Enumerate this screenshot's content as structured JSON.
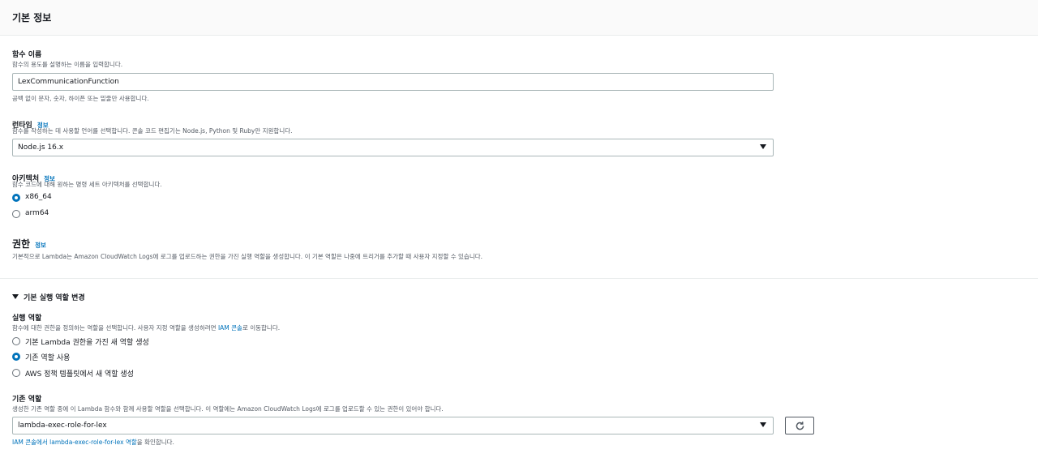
{
  "panel": {
    "title": "기본 정보"
  },
  "function_name": {
    "label": "함수 이름",
    "description": "함수의 용도를 설명하는 이름을 입력합니다.",
    "value": "LexCommunicationFunction",
    "hint": "공백 없이 문자, 숫자, 하이픈 또는 밑줄만 사용합니다."
  },
  "runtime": {
    "label": "런타임",
    "info": "정보",
    "description": "함수를 작성하는 데 사용할 언어를 선택합니다. 콘솔 코드 편집기는 Node.js, Python 및 Ruby만 지원합니다.",
    "value": "Node.js 16.x"
  },
  "architecture": {
    "label": "아키텍처",
    "info": "정보",
    "description": "함수 코드에 대해 원하는 명령 세트 아키텍처를 선택합니다.",
    "options": [
      "x86_64",
      "arm64"
    ],
    "selected": "x86_64"
  },
  "permissions": {
    "title": "권한",
    "info": "정보",
    "description": "기본적으로 Lambda는 Amazon CloudWatch Logs에 로그를 업로드하는 권한을 가진 실행 역할을 생성합니다. 이 기본 역할은 나중에 트리거를 추가할 때 사용자 지정할 수 있습니다."
  },
  "change_role": {
    "toggle_label": "기본 실행 역할 변경",
    "exec_role_label": "실행 역할",
    "exec_role_desc_prefix": "함수에 대한 권한을 정의하는 역할을 선택합니다. 사용자 지정 역할을 생성하려면 ",
    "exec_role_desc_link": "IAM 콘솔",
    "exec_role_desc_suffix": "로 이동합니다.",
    "options": [
      "기본 Lambda 권한을 가진 새 역할 생성",
      "기존 역할 사용",
      "AWS 정책 템플릿에서 새 역할 생성"
    ],
    "selected": "기존 역할 사용"
  },
  "existing_role": {
    "label": "기존 역할",
    "description": "생성한 기존 역할 중에 이 Lambda 함수와 함께 사용할 역할을 선택합니다. 이 역할에는 Amazon CloudWatch Logs에 로그를 업로드할 수 있는 권한이 있어야 합니다.",
    "value": "lambda-exec-role-for-lex",
    "link_text": "IAM 콘솔에서 lambda-exec-role-for-lex 역할",
    "link_suffix": "을 확인합니다."
  }
}
